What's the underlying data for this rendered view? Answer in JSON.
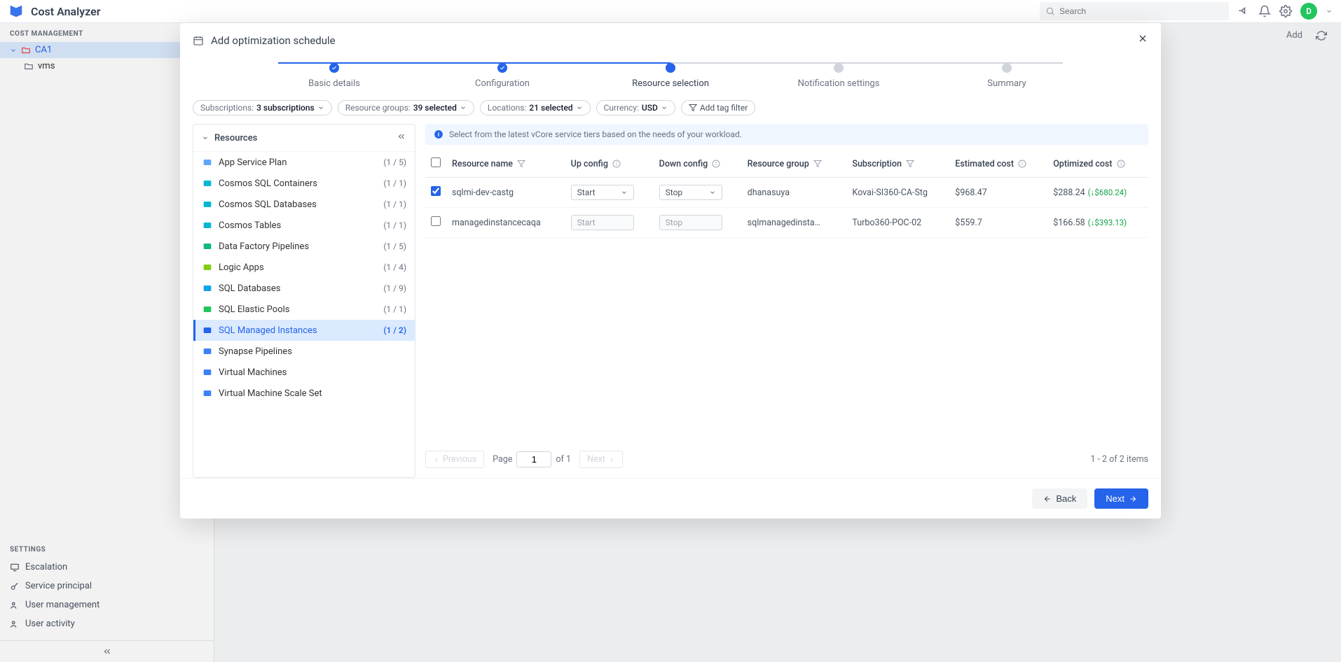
{
  "header": {
    "app_title": "Cost Analyzer",
    "search_placeholder": "Search",
    "avatar_letter": "D"
  },
  "left_nav": {
    "section1": "COST MANAGEMENT",
    "item_ca1": "CA1",
    "item_vms": "vms",
    "settings_title": "SETTINGS",
    "settings_items": [
      "Escalation",
      "Service principal",
      "User management",
      "User activity"
    ]
  },
  "bg": {
    "add": "Add"
  },
  "modal": {
    "title": "Add optimization schedule",
    "steps": [
      "Basic details",
      "Configuration",
      "Resource selection",
      "Notification settings",
      "Summary"
    ],
    "filters": {
      "subscriptions_label": "Subscriptions:",
      "subscriptions_value": "3 subscriptions",
      "rg_label": "Resource groups:",
      "rg_value": "39 selected",
      "loc_label": "Locations:",
      "loc_value": "21 selected",
      "currency_label": "Currency:",
      "currency_value": "USD",
      "tag_filter": "Add tag filter"
    },
    "resources_title": "Resources",
    "resource_types": [
      {
        "name": "App Service Plan",
        "count": "(1 / 5)"
      },
      {
        "name": "Cosmos SQL Containers",
        "count": "(1 / 1)"
      },
      {
        "name": "Cosmos SQL Databases",
        "count": "(1 / 1)"
      },
      {
        "name": "Cosmos Tables",
        "count": "(1 / 1)"
      },
      {
        "name": "Data Factory Pipelines",
        "count": "(1 / 5)"
      },
      {
        "name": "Logic Apps",
        "count": "(1 / 4)"
      },
      {
        "name": "SQL Databases",
        "count": "(1 / 9)"
      },
      {
        "name": "SQL Elastic Pools",
        "count": "(1 / 1)"
      },
      {
        "name": "SQL Managed Instances",
        "count": "(1 / 2)"
      },
      {
        "name": "Synapse Pipelines",
        "count": ""
      },
      {
        "name": "Virtual Machines",
        "count": ""
      },
      {
        "name": "Virtual Machine Scale Set",
        "count": ""
      }
    ],
    "info_banner": "Select from the latest vCore service tiers based on the needs of your workload.",
    "columns": {
      "resource_name": "Resource name",
      "up_config": "Up config",
      "down_config": "Down config",
      "resource_group": "Resource group",
      "subscription": "Subscription",
      "estimated_cost": "Estimated cost",
      "optimized_cost": "Optimized cost"
    },
    "rows": [
      {
        "checked": true,
        "name": "sqlmi-dev-castg",
        "up": "Start",
        "down": "Stop",
        "rg": "dhanasuya",
        "sub": "Kovai-SI360-CA-Stg",
        "est": "$968.47",
        "opt": "$288.24",
        "savings": "(↓$680.24)",
        "disabled": false
      },
      {
        "checked": false,
        "name": "managedinstancecaqa",
        "up": "Start",
        "down": "Stop",
        "rg": "sqlmanagedinstance...",
        "sub": "Turbo360-POC-02",
        "est": "$559.7",
        "opt": "$166.58",
        "savings": "(↓$393.13)",
        "disabled": true
      }
    ],
    "pagination": {
      "previous": "Previous",
      "page_label": "Page",
      "page_current": "1",
      "of": "of 1",
      "next": "Next",
      "summary": "1 - 2 of 2 items"
    },
    "footer": {
      "back": "Back",
      "next": "Next"
    }
  }
}
